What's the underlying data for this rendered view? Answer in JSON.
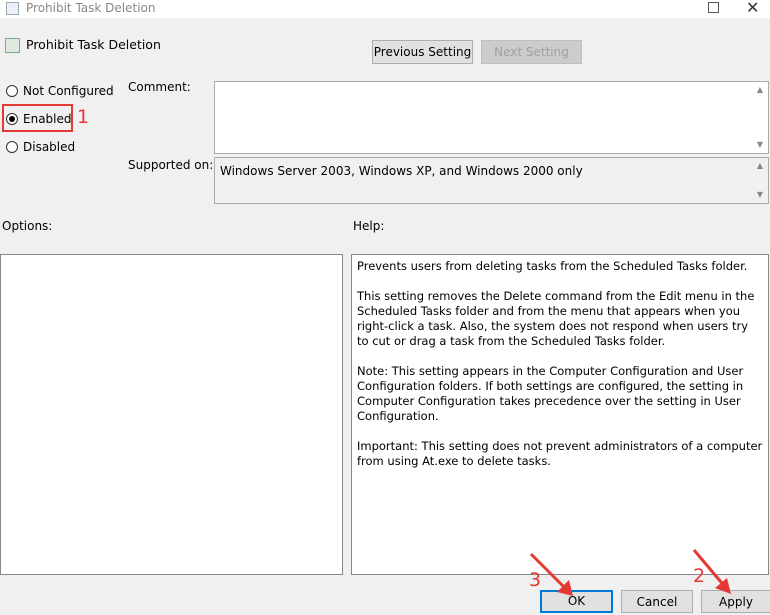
{
  "window": {
    "title": "Prohibit Task Deletion"
  },
  "header": {
    "title": "Prohibit Task Deletion"
  },
  "nav": {
    "previous_label": "Previous Setting",
    "next_label": "Next Setting"
  },
  "state": {
    "options": [
      {
        "label": "Not Configured",
        "selected": false
      },
      {
        "label": "Enabled",
        "selected": true
      },
      {
        "label": "Disabled",
        "selected": false
      }
    ]
  },
  "comment": {
    "label": "Comment:",
    "value": ""
  },
  "supported": {
    "label": "Supported on:",
    "value": "Windows Server 2003, Windows XP, and Windows 2000 only"
  },
  "options_section": {
    "label": "Options:"
  },
  "help": {
    "label": "Help:",
    "paragraphs": [
      "Prevents users from deleting tasks from the Scheduled Tasks folder.",
      "This setting removes the Delete command from the Edit menu in the Scheduled Tasks folder and from the menu that appears when you right-click a task. Also, the system does not respond when users try to cut or drag a task from the Scheduled Tasks folder.",
      "Note: This setting appears in the Computer Configuration and User Configuration folders. If both settings are configured, the setting in Computer Configuration takes precedence over the setting in User Configuration.",
      "Important: This setting does not prevent administrators of a computer from using At.exe to delete tasks."
    ]
  },
  "footer": {
    "ok_label": "OK",
    "cancel_label": "Cancel",
    "apply_label": "Apply"
  },
  "annotations": {
    "step1": "1",
    "step2": "2",
    "step3": "3"
  },
  "colors": {
    "annotation_red": "#e53935",
    "ok_border": "#0078d7"
  }
}
